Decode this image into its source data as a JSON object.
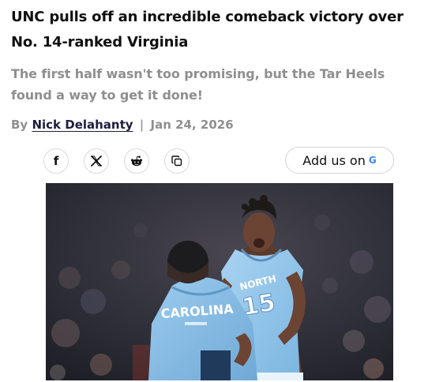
{
  "article": {
    "headline": "UNC pulls off an incredible comeback victory over No. 14-ranked Virginia",
    "subheadline": "The first half wasn't too promising, but the Tar Heels found a way to get it done!",
    "byline_prefix": "By",
    "author": "Nick Delahanty",
    "separator": "|",
    "date": "Jan 24, 2026"
  },
  "share": {
    "facebook_glyph": "f",
    "x_glyph": "𝕏",
    "icons": [
      "facebook-icon",
      "x-icon",
      "reddit-icon",
      "copy-link-icon"
    ]
  },
  "add_us": {
    "label": "Add us on",
    "brand_glyph": "G"
  },
  "photo": {
    "jersey_left_text": "CAROLINA",
    "jersey_right_text": "NORTH",
    "jersey_number": "15"
  },
  "colors": {
    "carolina_blue": "#8ec3ea",
    "byline_author": "#1d1d3f",
    "muted_text": "#8f8f8f"
  }
}
